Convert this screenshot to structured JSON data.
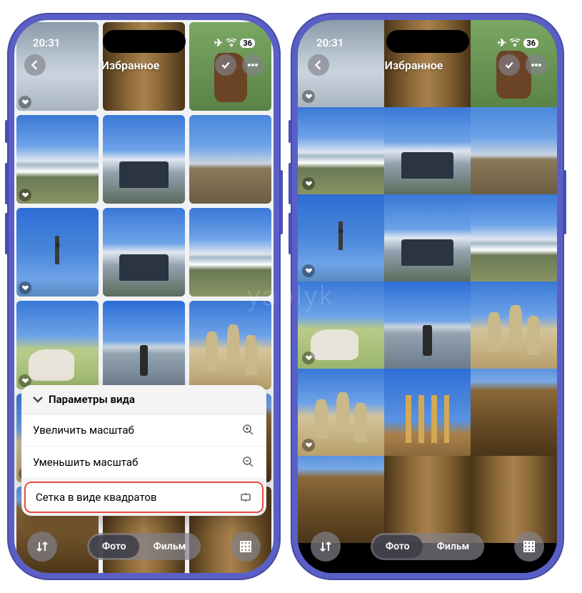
{
  "status": {
    "time": "20:31",
    "battery": "36"
  },
  "header": {
    "title": "Избранное"
  },
  "menu": {
    "header": "Параметры вида",
    "zoom_in": "Увеличить масштаб",
    "zoom_out": "Уменьшить масштаб",
    "square_grid": "Сетка в виде квадратов"
  },
  "bottom": {
    "photo": "Фото",
    "film": "Фильм"
  },
  "watermark": "yablyk"
}
